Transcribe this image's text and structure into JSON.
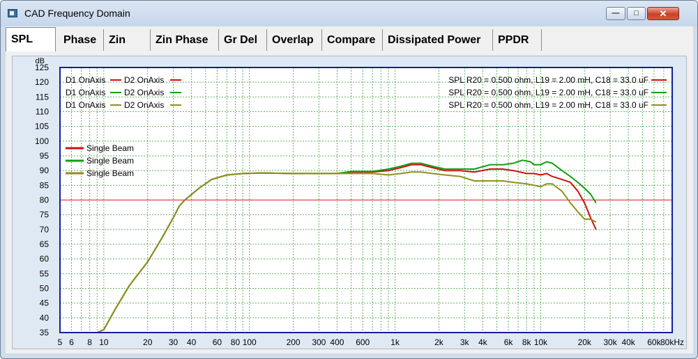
{
  "window": {
    "title": "CAD Frequency Domain",
    "minimize_glyph": "—",
    "maximize_glyph": "□",
    "close_glyph": "✕"
  },
  "tabs": [
    {
      "label": "SPL",
      "active": true
    },
    {
      "label": "Phase",
      "active": false
    },
    {
      "label": "Zin",
      "active": false
    },
    {
      "label": "Zin Phase",
      "active": false
    },
    {
      "label": "Gr Del",
      "active": false
    },
    {
      "label": "Overlap",
      "active": false
    },
    {
      "label": "Compare",
      "active": false
    },
    {
      "label": "Dissipated Power",
      "active": false
    },
    {
      "label": "PPDR",
      "active": false
    }
  ],
  "chart_data": {
    "type": "line",
    "x_scale": "log",
    "xlim": [
      5,
      80000
    ],
    "ylim": [
      35,
      125
    ],
    "ylabel": "dB",
    "grid": true,
    "y_ticks": [
      35,
      40,
      45,
      50,
      55,
      60,
      65,
      70,
      75,
      80,
      85,
      90,
      95,
      100,
      105,
      110,
      115,
      120,
      125
    ],
    "x_ticks": [
      {
        "v": 5,
        "label": "5"
      },
      {
        "v": 6,
        "label": "6"
      },
      {
        "v": 8,
        "label": "8"
      },
      {
        "v": 10,
        "label": "10"
      },
      {
        "v": 20,
        "label": "20"
      },
      {
        "v": 30,
        "label": "30"
      },
      {
        "v": 40,
        "label": "40"
      },
      {
        "v": 60,
        "label": "60"
      },
      {
        "v": 80,
        "label": "80"
      },
      {
        "v": 100,
        "label": "100"
      },
      {
        "v": 200,
        "label": "200"
      },
      {
        "v": 300,
        "label": "300"
      },
      {
        "v": 400,
        "label": "400"
      },
      {
        "v": 600,
        "label": "600"
      },
      {
        "v": 1000,
        "label": "1k"
      },
      {
        "v": 2000,
        "label": "2k"
      },
      {
        "v": 3000,
        "label": "3k"
      },
      {
        "v": 4000,
        "label": "4k"
      },
      {
        "v": 6000,
        "label": "6k"
      },
      {
        "v": 8000,
        "label": "8k"
      },
      {
        "v": 10000,
        "label": "10k"
      },
      {
        "v": 20000,
        "label": "20k"
      },
      {
        "v": 30000,
        "label": "30k"
      },
      {
        "v": 40000,
        "label": "40k"
      },
      {
        "v": 60000,
        "label": "60k"
      },
      {
        "v": 80000,
        "label": "80kHz"
      }
    ],
    "reference_line": {
      "y": 80,
      "color": "#d92020"
    },
    "legend_top_left": [
      {
        "d1": "D1 OnAxis",
        "d2": "D2 OnAxis",
        "color_d1": "#cc1010",
        "color_d2": "#cc1010"
      },
      {
        "d1": "D1 OnAxis",
        "d2": "D2 OnAxis",
        "color_d1": "#10a010",
        "color_d2": "#10a010"
      },
      {
        "d1": "D1 OnAxis",
        "d2": "D2 OnAxis",
        "color_d1": "#8f8f20",
        "color_d2": "#8f8f20"
      }
    ],
    "legend_top_right": [
      {
        "text": "SPL  R20 = 0.500 ohm, L19 = 2.00 mH, C18 = 33.0 uF",
        "color": "#cc1010"
      },
      {
        "text": "SPL  R20 = 0.500 ohm, L19 = 2.00 mH, C18 = 33.0 uF",
        "color": "#10a010"
      },
      {
        "text": "SPL  R20 = 0.500 ohm, L19 = 2.00 mH, C18 = 33.0 uF",
        "color": "#8f8f20"
      }
    ],
    "series": [
      {
        "name": "Single Beam",
        "color": "#cc1010",
        "points": [
          [
            5,
            35
          ],
          [
            9,
            35
          ],
          [
            10,
            36
          ],
          [
            12,
            43
          ],
          [
            15,
            51
          ],
          [
            20,
            59
          ],
          [
            25,
            67
          ],
          [
            30,
            74
          ],
          [
            33,
            78
          ],
          [
            36,
            80
          ],
          [
            45,
            84
          ],
          [
            55,
            87
          ],
          [
            70,
            88.5
          ],
          [
            90,
            89
          ],
          [
            120,
            89.2
          ],
          [
            200,
            89
          ],
          [
            300,
            89
          ],
          [
            400,
            89
          ],
          [
            500,
            89.5
          ],
          [
            700,
            89.5
          ],
          [
            900,
            90
          ],
          [
            1100,
            91
          ],
          [
            1300,
            92
          ],
          [
            1500,
            92
          ],
          [
            1800,
            91
          ],
          [
            2200,
            90
          ],
          [
            2800,
            90
          ],
          [
            3500,
            89.5
          ],
          [
            4500,
            90.5
          ],
          [
            5500,
            90.5
          ],
          [
            6500,
            90
          ],
          [
            8000,
            89
          ],
          [
            9000,
            89
          ],
          [
            10000,
            88.5
          ],
          [
            11000,
            89
          ],
          [
            12000,
            88
          ],
          [
            14000,
            87
          ],
          [
            16000,
            86
          ],
          [
            18000,
            83
          ],
          [
            20000,
            79
          ],
          [
            22000,
            74
          ],
          [
            24000,
            70
          ]
        ]
      },
      {
        "name": "Single Beam",
        "color": "#10a010",
        "points": [
          [
            5,
            35
          ],
          [
            9,
            35
          ],
          [
            10,
            36
          ],
          [
            12,
            43
          ],
          [
            15,
            51
          ],
          [
            20,
            59
          ],
          [
            25,
            67
          ],
          [
            30,
            74
          ],
          [
            33,
            78
          ],
          [
            36,
            80
          ],
          [
            45,
            84
          ],
          [
            55,
            87
          ],
          [
            70,
            88.5
          ],
          [
            90,
            89
          ],
          [
            120,
            89.2
          ],
          [
            200,
            89
          ],
          [
            300,
            89
          ],
          [
            400,
            89
          ],
          [
            500,
            89.7
          ],
          [
            700,
            89.7
          ],
          [
            900,
            90.5
          ],
          [
            1100,
            91.5
          ],
          [
            1300,
            92.5
          ],
          [
            1500,
            92.5
          ],
          [
            1800,
            91.5
          ],
          [
            2200,
            90.5
          ],
          [
            2800,
            90.5
          ],
          [
            3500,
            90.5
          ],
          [
            4500,
            92
          ],
          [
            5500,
            92
          ],
          [
            6500,
            92.5
          ],
          [
            7500,
            93.5
          ],
          [
            8500,
            93
          ],
          [
            9000,
            92
          ],
          [
            10000,
            92
          ],
          [
            11000,
            93
          ],
          [
            12000,
            92.5
          ],
          [
            14000,
            90
          ],
          [
            16000,
            88
          ],
          [
            18000,
            86
          ],
          [
            20000,
            84
          ],
          [
            22000,
            82
          ],
          [
            24000,
            79
          ]
        ]
      },
      {
        "name": "Single Beam",
        "color": "#8f8f20",
        "points": [
          [
            5,
            35
          ],
          [
            9,
            35
          ],
          [
            10,
            36
          ],
          [
            12,
            43
          ],
          [
            15,
            51
          ],
          [
            20,
            59
          ],
          [
            25,
            67
          ],
          [
            30,
            74
          ],
          [
            33,
            78
          ],
          [
            36,
            80
          ],
          [
            45,
            84
          ],
          [
            55,
            87
          ],
          [
            70,
            88.5
          ],
          [
            90,
            89
          ],
          [
            120,
            89.2
          ],
          [
            200,
            89
          ],
          [
            300,
            89
          ],
          [
            400,
            89
          ],
          [
            500,
            89
          ],
          [
            700,
            89
          ],
          [
            900,
            88.5
          ],
          [
            1100,
            89
          ],
          [
            1300,
            89.5
          ],
          [
            1500,
            89.5
          ],
          [
            1800,
            89
          ],
          [
            2200,
            88.5
          ],
          [
            2800,
            88
          ],
          [
            3500,
            86.5
          ],
          [
            4500,
            86.5
          ],
          [
            5500,
            86.5
          ],
          [
            6500,
            86
          ],
          [
            8000,
            85.5
          ],
          [
            9000,
            85
          ],
          [
            10000,
            84.5
          ],
          [
            11000,
            85.5
          ],
          [
            12000,
            85.5
          ],
          [
            14000,
            83
          ],
          [
            16000,
            79
          ],
          [
            18000,
            76
          ],
          [
            20000,
            73.5
          ],
          [
            22000,
            73.5
          ],
          [
            24000,
            72.5
          ]
        ]
      }
    ]
  }
}
